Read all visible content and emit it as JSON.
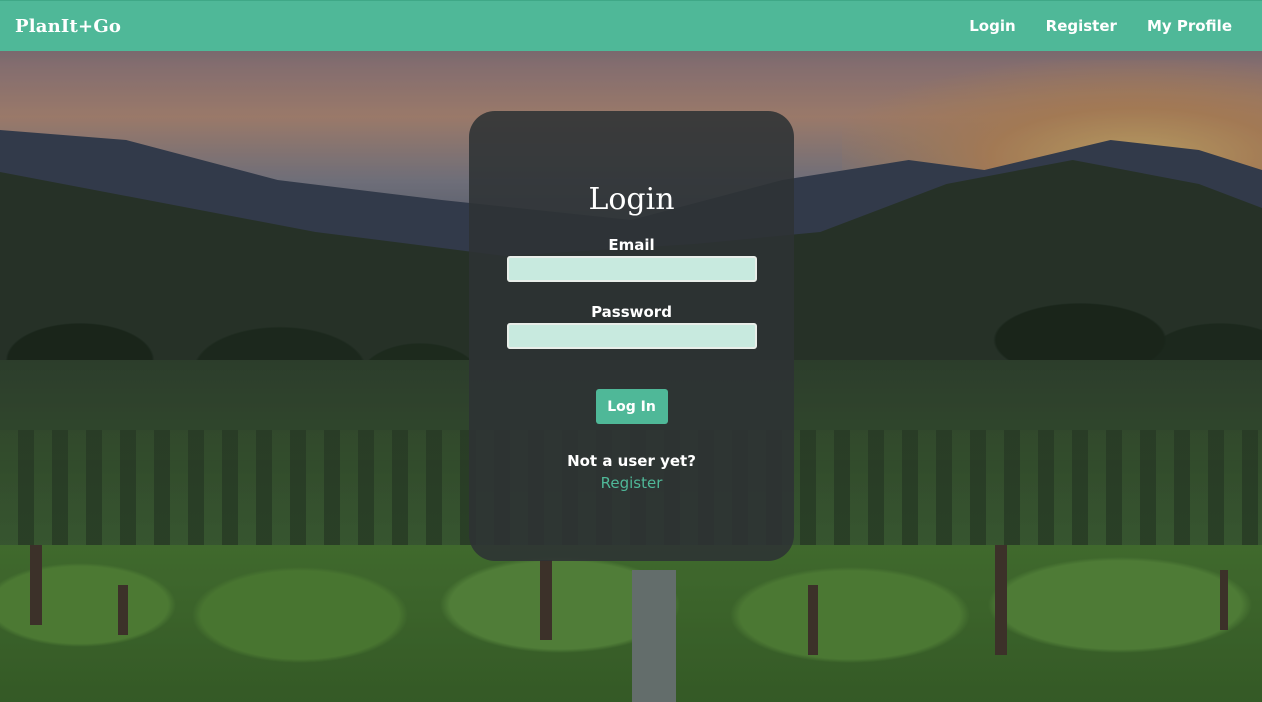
{
  "navbar": {
    "brand": "PlanIt+Go",
    "links": [
      {
        "label": "Login"
      },
      {
        "label": "Register"
      },
      {
        "label": "My Profile"
      }
    ]
  },
  "login_card": {
    "title": "Login",
    "email_label": "Email",
    "email_value": "",
    "password_label": "Password",
    "password_value": "",
    "submit_label": "Log In",
    "prompt": "Not a user yet?",
    "register_link": "Register"
  },
  "colors": {
    "accent": "#4fb898",
    "input_bg": "#c8eadf",
    "card_bg": "#2d3234"
  }
}
